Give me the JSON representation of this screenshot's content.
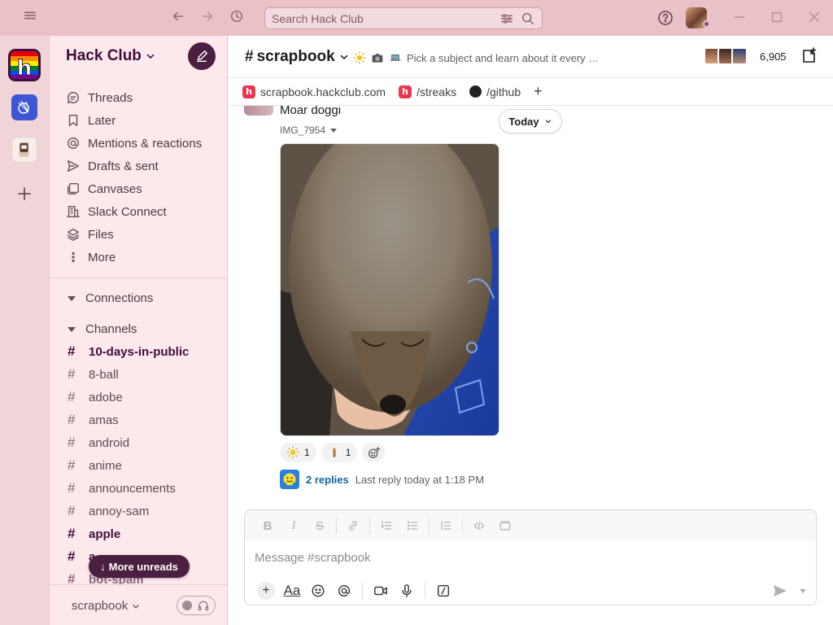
{
  "titlebar": {
    "search_placeholder": "Search Hack Club",
    "icons": [
      "hamburger-icon",
      "back-arrow-icon",
      "forward-arrow-icon",
      "history-icon",
      "filter-icon",
      "search-icon",
      "help-icon",
      "minimize-icon",
      "maximize-icon",
      "close-icon"
    ]
  },
  "workspace": {
    "name": "Hack Club"
  },
  "sidebar": {
    "nav": [
      {
        "label": "Threads",
        "icon": "threads-icon"
      },
      {
        "label": "Later",
        "icon": "bookmark-icon"
      },
      {
        "label": "Mentions & reactions",
        "icon": "at-icon"
      },
      {
        "label": "Drafts & sent",
        "icon": "send-icon"
      },
      {
        "label": "Canvases",
        "icon": "canvas-icon"
      },
      {
        "label": "Slack Connect",
        "icon": "building-icon"
      },
      {
        "label": "Files",
        "icon": "layers-icon"
      },
      {
        "label": "More",
        "icon": "more-vertical-icon"
      }
    ],
    "connections_label": "Connections",
    "channels_label": "Channels",
    "channels": [
      {
        "name": "10-days-in-public",
        "unread": true
      },
      {
        "name": "8-ball",
        "unread": false
      },
      {
        "name": "adobe",
        "unread": false
      },
      {
        "name": "amas",
        "unread": false
      },
      {
        "name": "android",
        "unread": false
      },
      {
        "name": "anime",
        "unread": false
      },
      {
        "name": "announcements",
        "unread": false
      },
      {
        "name": "annoy-sam",
        "unread": false
      },
      {
        "name": "apple",
        "unread": true
      },
      {
        "name": "a",
        "unread": true
      },
      {
        "name": "bot-spam",
        "unread": true
      }
    ],
    "more_unreads": "More unreads",
    "footer_name": "scrapbook"
  },
  "channel": {
    "name": "scrapbook",
    "topic": "Pick a subject and learn about it every …",
    "member_count": "6,905",
    "bookmarks": [
      {
        "label": "scrapbook.hackclub.com",
        "icon": "hackclub-icon"
      },
      {
        "label": "/streaks",
        "icon": "hackclub-icon"
      },
      {
        "label": "/github",
        "icon": "github-icon"
      }
    ]
  },
  "message": {
    "text": "Moar doggi",
    "file_name": "IMG_7954",
    "date_divider": "Today",
    "reactions": [
      {
        "emoji": "sun-emoji",
        "count": "1"
      },
      {
        "emoji": "bread-emoji",
        "count": "1"
      }
    ],
    "replies_link": "2 replies",
    "replies_meta": "Last reply today at 1:18 PM"
  },
  "composer": {
    "placeholder": "Message #scrapbook",
    "aa_label": "Aa"
  },
  "colors": {
    "aubergine": "#3f0e40",
    "sidebar_bg": "#fde9ec",
    "titlebar_bg": "#e9c1c7",
    "link": "#1264a3"
  }
}
